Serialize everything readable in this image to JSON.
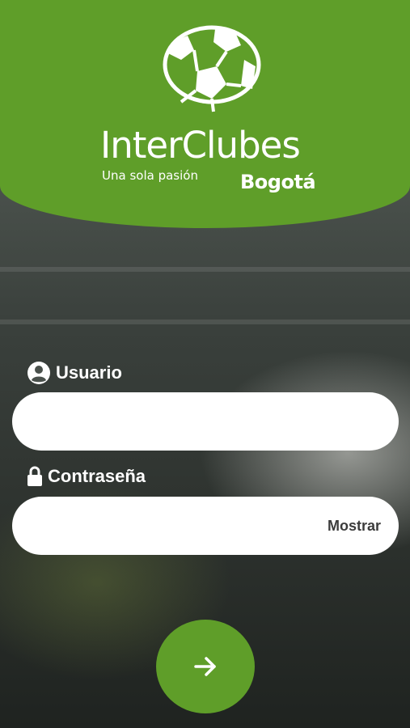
{
  "brand": {
    "name": "InterClubes",
    "slogan": "Una sola pasión",
    "city": "Bogotá"
  },
  "form": {
    "username": {
      "label": "Usuario",
      "value": "",
      "icon": "user-circle-icon"
    },
    "password": {
      "label": "Contraseña",
      "value": "",
      "icon": "lock-icon",
      "show_label": "Mostrar"
    },
    "submit": {
      "icon": "arrow-right-icon"
    }
  },
  "colors": {
    "primary_green": "#5f9e29",
    "input_background": "#ffffff",
    "label_text": "#ffffff",
    "show_text": "#3c3c3c"
  }
}
